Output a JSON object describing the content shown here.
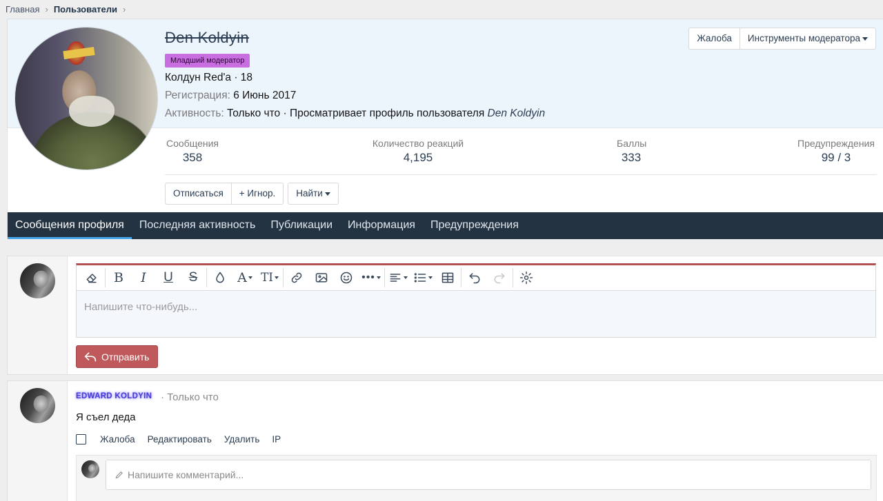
{
  "breadcrumb": {
    "home": "Главная",
    "current": "Пользователи"
  },
  "profile": {
    "username": "Den Koldyin",
    "role_badge": "Младший модератор",
    "title_line": "Колдун Red'a · 18",
    "registration_label": "Регистрация:",
    "registration_value": "6 Июнь 2017",
    "activity_label": "Активность:",
    "activity_value": "Только что · Просматривает профиль пользователя",
    "activity_link": "Den Koldyin",
    "report_button": "Жалоба",
    "mod_tools_button": "Инструменты модератора",
    "stats": [
      {
        "label": "Сообщения",
        "value": "358"
      },
      {
        "label": "Количество реакций",
        "value": "4,195"
      },
      {
        "label": "Баллы",
        "value": "333"
      },
      {
        "label": "Предупреждения",
        "value": "99 / 3"
      }
    ],
    "unfollow_button": "Отписаться",
    "ignore_button": "+ Игнор.",
    "find_button": "Найти"
  },
  "tabs": [
    {
      "label": "Сообщения профиля",
      "active": true
    },
    {
      "label": "Последняя активность"
    },
    {
      "label": "Публикации"
    },
    {
      "label": "Информация"
    },
    {
      "label": "Предупреждения"
    }
  ],
  "composer": {
    "placeholder": "Напишите что-нибудь...",
    "send_button": "Отправить"
  },
  "post": {
    "author": "EDWARD KOLDYIN",
    "time": "· Только что",
    "text": "Я съел деда",
    "actions": [
      "Жалоба",
      "Редактировать",
      "Удалить",
      "IP"
    ],
    "comment_placeholder": "Напишите комментарий..."
  },
  "colors": {
    "accent": "#47a7eb",
    "tab_bar": "#243342",
    "send_button": "#c0595b",
    "role_badge": "#c96ee0"
  }
}
